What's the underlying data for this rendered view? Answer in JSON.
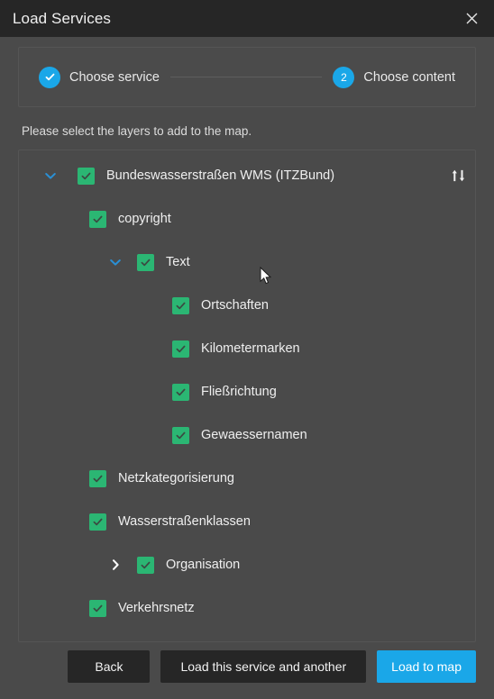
{
  "window": {
    "title": "Load Services",
    "close_icon": "close-icon"
  },
  "stepper": {
    "steps": [
      {
        "label": "Choose service",
        "marker": "check",
        "state": "completed"
      },
      {
        "label": "Choose content",
        "marker": "2",
        "state": "active"
      }
    ],
    "accent_color": "#1aa7e8"
  },
  "content": {
    "instruction": "Please select the layers to add to the map.",
    "sort_icon": "sort-updown-icon",
    "checkbox_color": "#2bb673",
    "tree": [
      {
        "label": "Bundeswasserstraßen WMS (ITZBund)",
        "level": 0,
        "checked": true,
        "expander": "down",
        "expander_color": "blue",
        "has_sort": true
      },
      {
        "label": "copyright",
        "level": 1,
        "checked": true,
        "expander": "none"
      },
      {
        "label": "Text",
        "level": 2,
        "checked": true,
        "expander": "down",
        "expander_color": "blue"
      },
      {
        "label": "Ortschaften",
        "level": 3,
        "checked": true,
        "expander": "none"
      },
      {
        "label": "Kilometermarken",
        "level": 3,
        "checked": true,
        "expander": "none"
      },
      {
        "label": "Fließrichtung",
        "level": 3,
        "checked": true,
        "expander": "none"
      },
      {
        "label": "Gewaessernamen",
        "level": 3,
        "checked": true,
        "expander": "none"
      },
      {
        "label": "Netzkategorisierung",
        "level": 1,
        "checked": true,
        "expander": "none"
      },
      {
        "label": "Wasserstraßenklassen",
        "level": 1,
        "checked": true,
        "expander": "none"
      },
      {
        "label": "Organisation",
        "level": 2,
        "checked": true,
        "expander": "right",
        "expander_color": "white"
      },
      {
        "label": "Verkehrsnetz",
        "level": 1,
        "checked": true,
        "expander": "none"
      }
    ]
  },
  "footer": {
    "back_label": "Back",
    "load_another_label": "Load this service and another",
    "load_to_map_label": "Load to map",
    "primary_color": "#1aa7e8"
  }
}
